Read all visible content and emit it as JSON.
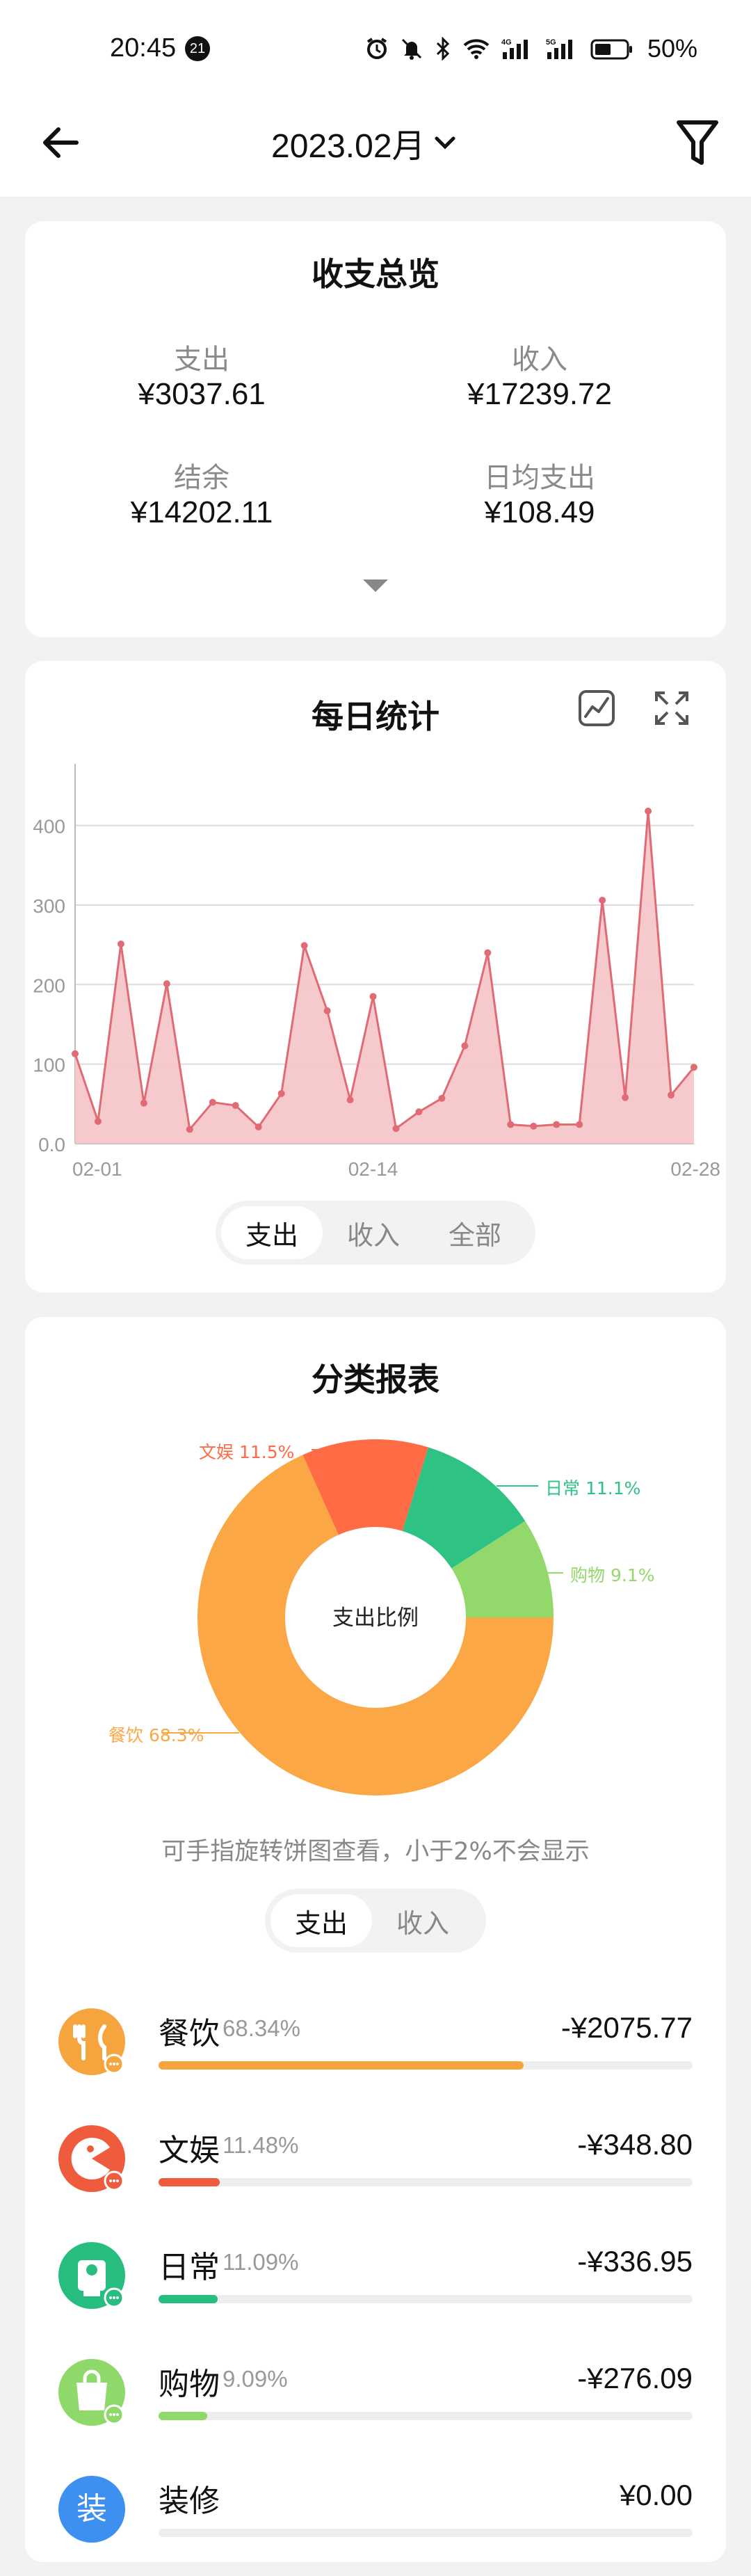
{
  "status_bar": {
    "time": "20:45",
    "notification_count": "21",
    "battery": "50%"
  },
  "header": {
    "title": "2023.02月"
  },
  "overview": {
    "title": "收支总览",
    "items": [
      {
        "label": "支出",
        "value": "¥3037.61"
      },
      {
        "label": "收入",
        "value": "¥17239.72"
      },
      {
        "label": "结余",
        "value": "¥14202.11"
      },
      {
        "label": "日均支出",
        "value": "¥108.49"
      }
    ]
  },
  "daily": {
    "title": "每日统计",
    "tabs": [
      "支出",
      "收入",
      "全部"
    ],
    "active_tab": "支出"
  },
  "chart_data": {
    "type": "area",
    "title": "每日统计",
    "x_tick_labels": [
      "02-01",
      "02-14",
      "02-28"
    ],
    "y_ticks": [
      "0.0",
      "100",
      "200",
      "300",
      "400"
    ],
    "ylim": [
      0,
      460
    ],
    "x": [
      "02-01",
      "02-02",
      "02-03",
      "02-04",
      "02-05",
      "02-06",
      "02-07",
      "02-08",
      "02-09",
      "02-10",
      "02-11",
      "02-12",
      "02-13",
      "02-14",
      "02-15",
      "02-16",
      "02-17",
      "02-18",
      "02-19",
      "02-20",
      "02-21",
      "02-22",
      "02-23",
      "02-24",
      "02-25",
      "02-26",
      "02-27",
      "02-28"
    ],
    "values": [
      113,
      28,
      251,
      51,
      201,
      18,
      52,
      48,
      21,
      63,
      249,
      167,
      55,
      185,
      19,
      40,
      57,
      123,
      240,
      24,
      22,
      24,
      24,
      306,
      58,
      418,
      61,
      96
    ],
    "color": "#e06b74",
    "fill": "#f6c6ca",
    "grid": true
  },
  "category_report": {
    "title": "分类报表",
    "pie_center_label": "支出比例",
    "hint": "可手指旋转饼图查看，小于2%不会显示",
    "tabs": [
      "支出",
      "收入"
    ],
    "active_tab": "支出",
    "pie": [
      {
        "label": "餐饮 68.3%",
        "value": 68.3,
        "color": "#fca745"
      },
      {
        "label": "文娱 11.5%",
        "value": 11.5,
        "color": "#ff6b45"
      },
      {
        "label": "日常 11.1%",
        "value": 11.1,
        "color": "#2ec384"
      },
      {
        "label": "购物 9.1%",
        "value": 9.1,
        "color": "#93d86b"
      }
    ],
    "items": [
      {
        "name": "餐饮",
        "pct": "68.34%",
        "amount": "-¥2075.77",
        "ratio": 0.6834,
        "color": "#f6a43d",
        "icon": "fork-knife-icon"
      },
      {
        "name": "文娱",
        "pct": "11.48%",
        "amount": "-¥348.80",
        "ratio": 0.1148,
        "color": "#ef5b3d",
        "icon": "pacman-icon"
      },
      {
        "name": "日常",
        "pct": "11.09%",
        "amount": "-¥336.95",
        "ratio": 0.1109,
        "color": "#27bd7e",
        "icon": "toilet-roll-icon"
      },
      {
        "name": "购物",
        "pct": "9.09%",
        "amount": "-¥276.09",
        "ratio": 0.0909,
        "color": "#8fd86a",
        "icon": "shopping-bag-icon"
      },
      {
        "name": "装修",
        "pct": "",
        "amount": "¥0.00",
        "ratio": 0,
        "color": "#3d8ff0",
        "icon": "decoration-icon",
        "icon_char": "装"
      }
    ]
  }
}
